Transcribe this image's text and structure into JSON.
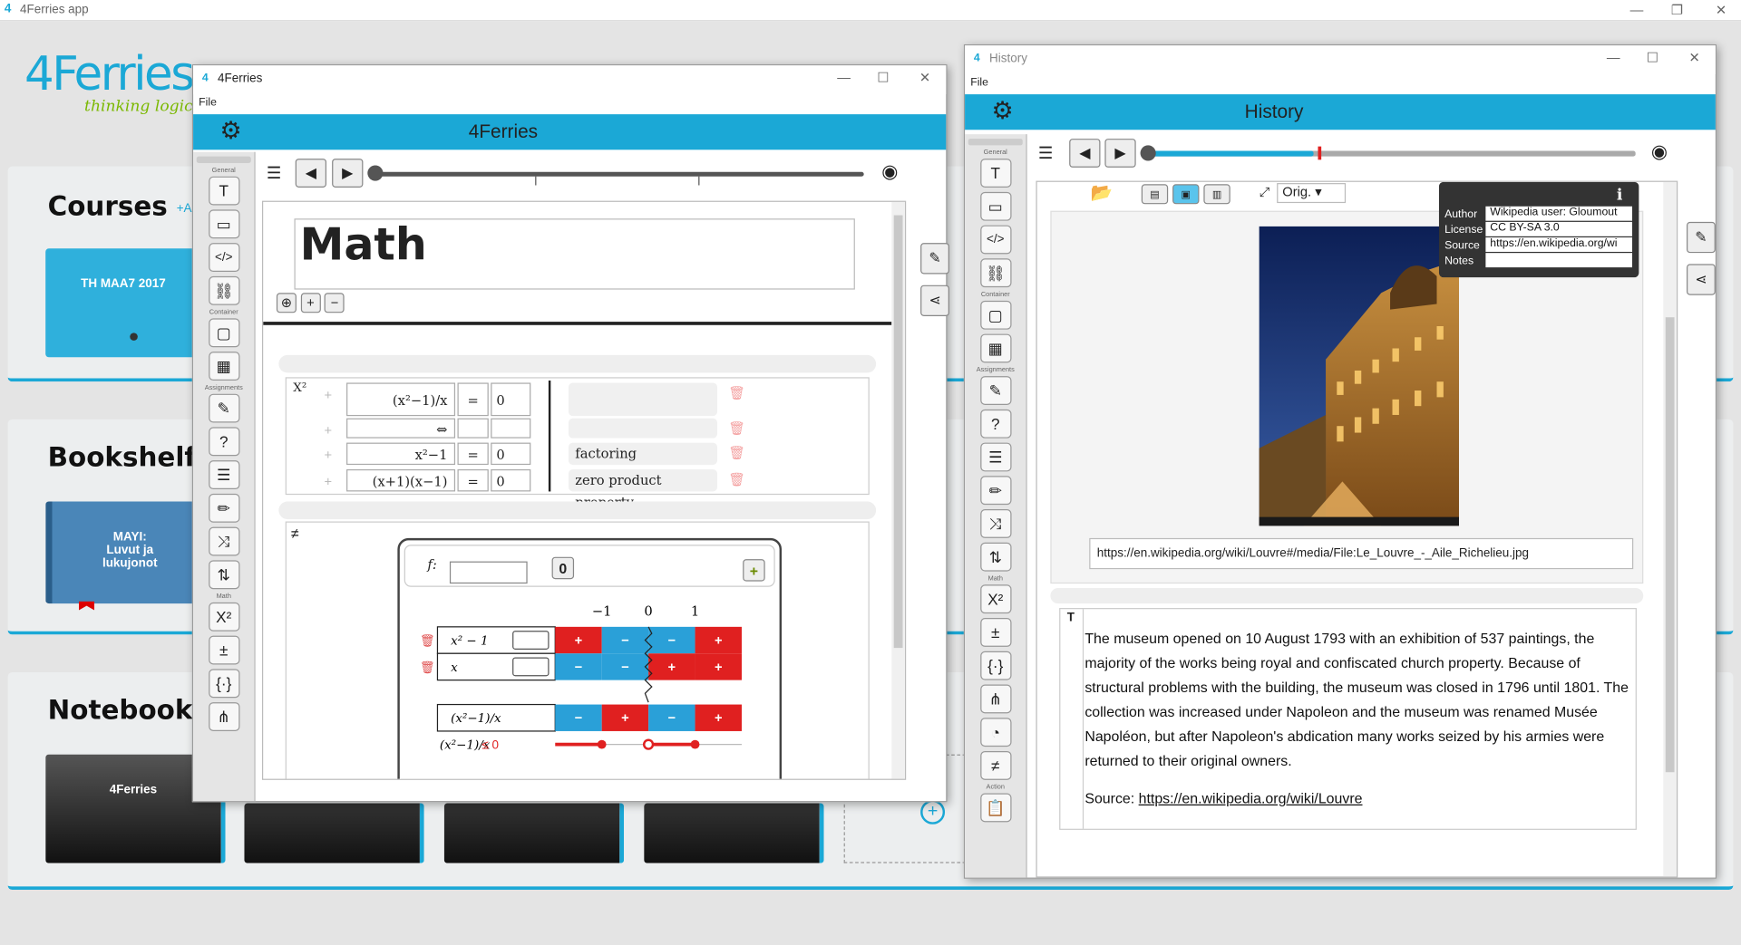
{
  "app": {
    "title": "4Ferries app"
  },
  "brand": {
    "logo_text": "4Ferries",
    "tagline": "thinking logical"
  },
  "shelves": {
    "courses": {
      "title": "Courses",
      "add_label": "+A",
      "card": "TH MAA7 2017"
    },
    "bookshelf": {
      "title": "Bookshelf",
      "card": "MAYI: Luvut ja lukujonot"
    },
    "notebook": {
      "title": "Notebook",
      "card": "4Ferries"
    }
  },
  "editor": {
    "window_title": "4Ferries",
    "menu_file": "File",
    "header_title": "4Ferries",
    "doc_title": "Math",
    "toolbar_labels": {
      "general": "General",
      "container": "Container",
      "assignments": "Assignments",
      "math": "Math"
    },
    "algebra": {
      "label": "X²",
      "rows": [
        {
          "expr": "(x²−1)/x",
          "rel": "=",
          "rhs": "0",
          "note": ""
        },
        {
          "expr": "⇔",
          "rel": "",
          "rhs": "",
          "note": ""
        },
        {
          "expr": "x²−1",
          "rel": "=",
          "rhs": "0",
          "note": "factoring"
        },
        {
          "expr": "(x+1)(x−1)",
          "rel": "=",
          "rhs": "0",
          "note": "zero product property"
        }
      ]
    },
    "sign_chart": {
      "f_label": "f:",
      "count": "0",
      "x_ticks": [
        "−1",
        "0",
        "1"
      ],
      "rows": [
        {
          "label": "x² − 1",
          "signs": [
            "+",
            "−",
            "−",
            "+"
          ]
        },
        {
          "label": "x",
          "signs": [
            "−",
            "−",
            "+",
            "+"
          ]
        },
        {
          "label": "(x²−1)/x",
          "signs": [
            "−",
            "+",
            "−",
            "+"
          ]
        }
      ],
      "inequality_lhs": "(x²−1)/x",
      "inequality_rhs": "≤ 0"
    }
  },
  "history": {
    "window_title": "History",
    "menu_file": "File",
    "header_title": "History",
    "size_select": "Orig.",
    "image_url": "https://en.wikipedia.org/wiki/Louvre#/media/File:Le_Louvre_-_Aile_Richelieu.jpg",
    "info": {
      "icon": "i",
      "author_label": "Author",
      "author": "Wikipedia user: Gloumout",
      "license_label": "License",
      "license": "CC BY-SA 3.0",
      "source_label": "Source",
      "source": "https://en.wikipedia.org/wi",
      "notes_label": "Notes",
      "notes": ""
    },
    "text_label": "T",
    "paragraph": "The museum opened on 10 August 1793 with an exhibition of 537 paintings, the majority of the works being royal and confiscated church property. Because of structural problems with the building, the museum was closed in 1796 until 1801. The collection was increased under Napoleon and the museum was renamed Musée Napoléon, but after Napoleon's abdication many works seized by his armies were returned to their original owners.",
    "source_prefix": "Source: ",
    "source_link": "https://en.wikipedia.org/wiki/Louvre",
    "toolbar_labels": {
      "general": "General",
      "container": "Container",
      "assignments": "Assignments",
      "math": "Math",
      "action": "Action"
    }
  },
  "colors": {
    "accent": "#1ba8d6",
    "plus": "#e02020",
    "minus": "#2aa0d8"
  }
}
